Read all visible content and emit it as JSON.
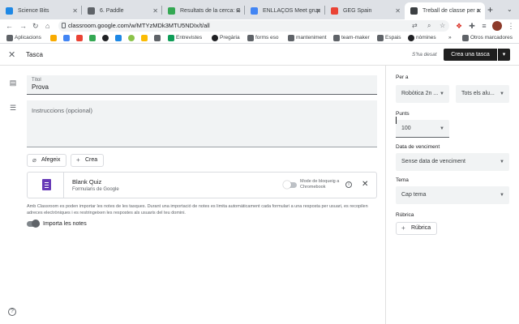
{
  "browser": {
    "tabs": [
      {
        "title": "Science Bits",
        "color": "#1e88e5"
      },
      {
        "title": "6. Paddle",
        "color": "#5f6368"
      },
      {
        "title": "Resultats de la cerca: G",
        "color": "#34a853"
      },
      {
        "title": "ENLLAÇOS Meet grup",
        "color": "#4285f4"
      },
      {
        "title": "GEG Spain",
        "color": "#ea4335"
      },
      {
        "title": "Treball de classe per a",
        "color": "#3c4043"
      }
    ],
    "url": "classroom.google.com/w/MTYzMDk3MTU5NDIx/t/all",
    "bookmarks": [
      {
        "label": "Aplicacions",
        "color": "#5f6368"
      },
      {
        "label": "",
        "color": "#f9ab00"
      },
      {
        "label": "",
        "color": "#ea4335"
      },
      {
        "label": "",
        "color": "#34a853"
      },
      {
        "label": "",
        "color": "#202124"
      },
      {
        "label": "",
        "color": "#1e88e5"
      },
      {
        "label": "",
        "color": "#34a853"
      },
      {
        "label": "",
        "color": "#fbbc04"
      },
      {
        "label": "",
        "color": "#5f6368"
      },
      {
        "label": "Entrevistes",
        "color": "#0f9d58"
      },
      {
        "label": "Pregària",
        "color": "#202124"
      },
      {
        "label": "forms eso",
        "color": "#5f6368"
      },
      {
        "label": "manteniment",
        "color": "#5f6368"
      },
      {
        "label": "team-maker",
        "color": "#5f6368"
      },
      {
        "label": "Espais",
        "color": "#5f6368"
      },
      {
        "label": "nòmines",
        "color": "#202124"
      },
      {
        "label": "»",
        "color": "#ffffff"
      },
      {
        "label": "Otros marcadores",
        "color": "#5f6368"
      }
    ]
  },
  "header": {
    "title": "Tasca",
    "saved_status": "S'ha desat",
    "assign_label": "Crea una tasca",
    "assign_menu": "▾"
  },
  "form": {
    "title_label": "Títol",
    "title_value": "Prova",
    "instructions_placeholder": "Instruccions (opcional)",
    "add_label": "Afegeix",
    "create_label": "Crea"
  },
  "attachment": {
    "name": "Blank Quiz",
    "type": "Formularis de Google",
    "lock_label": "Mode de bloqueig a Chromebook"
  },
  "grading_note": "Amb Classroom es poden importar les notes de les tasques. Durant una importació de notes es limita automàticament cada formulari a una resposta per usuari, es recopilen adreces electròniques i es restringeixen les respostes als usuaris del teu domini.",
  "import_grades_label": "Importa les notes",
  "sidebar": {
    "for_label": "Per a",
    "class_value": "Robòtica 2n ...",
    "students_value": "Tots els alu...",
    "points_label": "Punts",
    "points_value": "100",
    "due_label": "Data de venciment",
    "due_value": "Sense data de venciment",
    "topic_label": "Tema",
    "topic_value": "Cap tema",
    "rubric_label": "Rúbrica",
    "rubric_button": "Rúbrica"
  }
}
